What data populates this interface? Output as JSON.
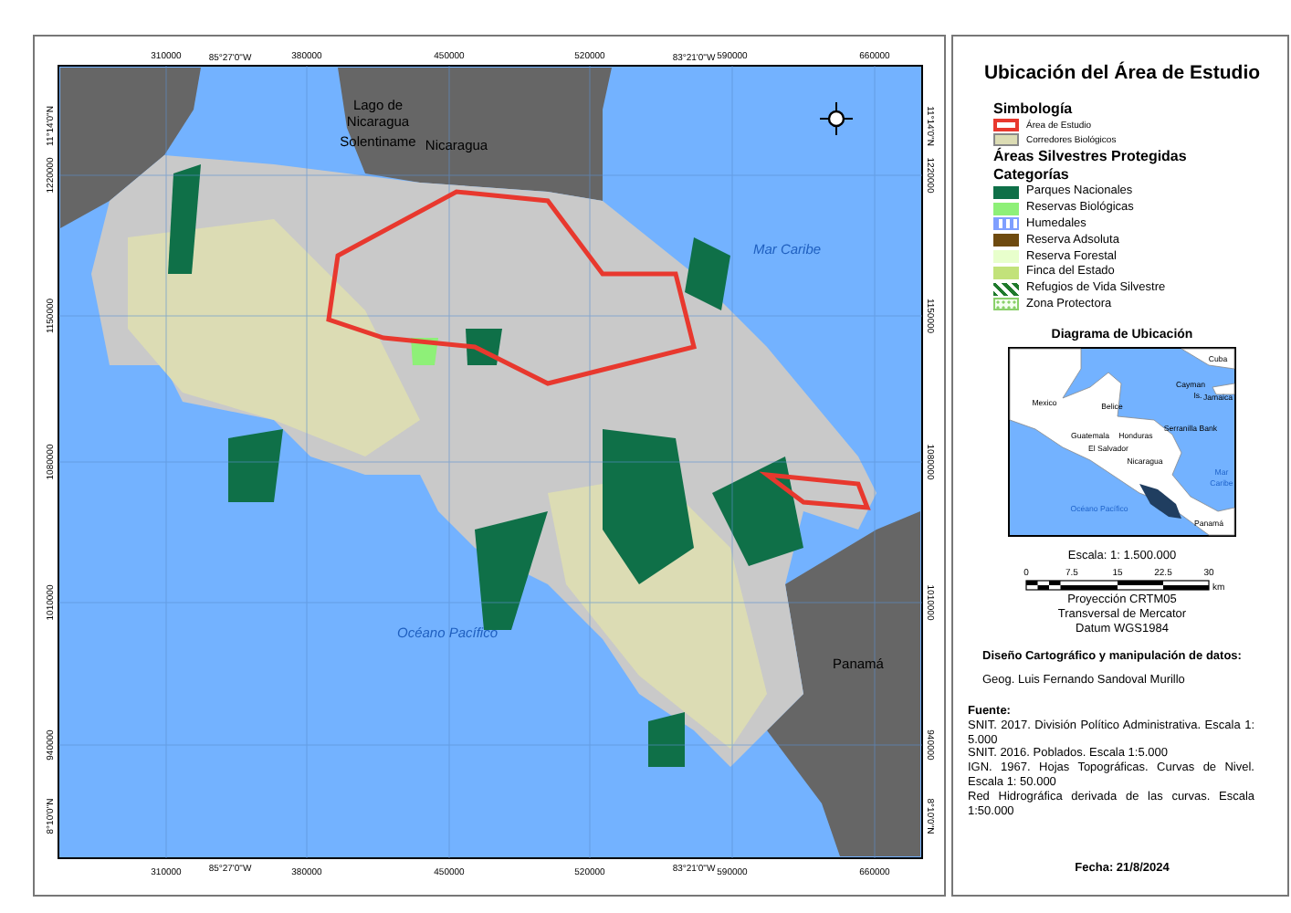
{
  "map": {
    "top_ticks": [
      "310000",
      "380000",
      "450000",
      "520000",
      "590000",
      "660000"
    ],
    "top_dms": [
      "85°27'0\"W",
      "83°21'0\"W"
    ],
    "bottom_ticks": [
      "310000",
      "380000",
      "450000",
      "520000",
      "590000",
      "660000"
    ],
    "bottom_dms": [
      "85°27'0\"W",
      "83°21'0\"W"
    ],
    "left_ticks": [
      "1220000",
      "1150000",
      "1080000",
      "1010000",
      "940000"
    ],
    "left_dms": [
      "11°14'0\"N",
      "8°10'0\"N"
    ],
    "right_ticks": [
      "1220000",
      "1150000",
      "1080000",
      "1010000",
      "940000"
    ],
    "right_dms": [
      "11°14'0\"N",
      "8°10'0\"N"
    ],
    "places": [
      {
        "text": "Lago de",
        "kind": "water"
      },
      {
        "text": "Nicaragua",
        "kind": "water"
      },
      {
        "text": "Solentiname",
        "kind": "land"
      },
      {
        "text": "Nicaragua",
        "kind": "land"
      },
      {
        "text": "Mar Caribe",
        "kind": "sea"
      },
      {
        "text": "Océano Pacífico",
        "kind": "sea"
      },
      {
        "text": "Panamá",
        "kind": "land"
      }
    ]
  },
  "panel": {
    "title": "Ubicación del Área de Estudio",
    "symbology_heading": "Simbología",
    "symbols": [
      {
        "label": "Área de Estudio",
        "kind": "study"
      },
      {
        "label": "Corredores Biológicos",
        "kind": "corridor"
      }
    ],
    "protected_heading": "Áreas Silvestres Protegidas",
    "categories_heading": "Categorías",
    "categories": [
      {
        "label": "Parques Nacionales",
        "kind": "fill",
        "color": "#0f7048"
      },
      {
        "label": "Reservas Biológicas",
        "kind": "fill",
        "color": "#8ef078"
      },
      {
        "label": "Humedales",
        "kind": "wetland",
        "color": "#7f9fff"
      },
      {
        "label": "Reserva Adsoluta",
        "kind": "fill",
        "color": "#6e4a10"
      },
      {
        "label": "Reserva Forestal",
        "kind": "fill",
        "color": "#e8ffcc"
      },
      {
        "label": "Finca del Estado",
        "kind": "fill",
        "color": "#c2e27a"
      },
      {
        "label": "Refugios de Vida Silvestre",
        "kind": "hatch",
        "color": "#1f7a2c"
      },
      {
        "label": "Zona Protectora",
        "kind": "dotted",
        "color": "#8ad06a"
      }
    ],
    "inset_title": "Diagrama de Ubicación",
    "inset_labels": [
      "Cuba",
      "Cayman",
      "Is.",
      "Jamaica",
      "Mexico",
      "Belice",
      "Serranilla Bank",
      "Guatemala",
      "Honduras",
      "El Salvador",
      "Nicaragua",
      "Mar",
      "Caribe",
      "Océano Pacífico",
      "Panamá"
    ],
    "scale_text": "Escala: 1: 1.500.000",
    "scale_ticks": [
      "0",
      "7.5",
      "15",
      "22.5",
      "30"
    ],
    "scale_unit": "km",
    "projection": [
      "Proyección CRTM05",
      "Transversal de Mercator",
      "Datum WGS1984"
    ],
    "design_heading": "Diseño Cartográfico y manipulación de datos:",
    "author": "Geog. Luis Fernando Sandoval Murillo",
    "source_heading": "Fuente:",
    "sources": [
      "SNIT. 2017. División Político Administrativa. Escala 1: 5.000",
      "SNIT. 2016. Poblados. Escala 1:5.000",
      "IGN. 1967. Hojas Topográficas. Curvas de Nivel. Escala 1: 50.000",
      "Red Hidrográfica derivada de las curvas. Escala 1:50.000"
    ],
    "date": "Fecha: 21/8/2024"
  }
}
